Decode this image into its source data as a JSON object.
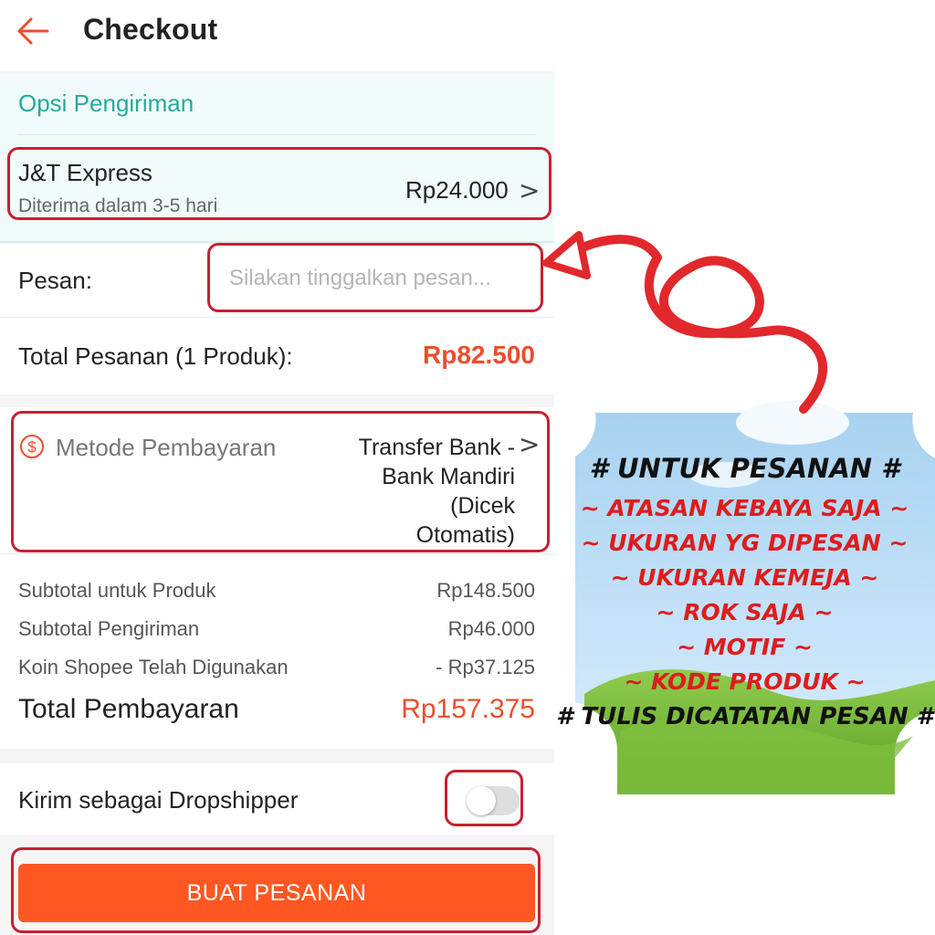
{
  "header": {
    "title": "Checkout",
    "back_icon": "arrow-left-icon",
    "accent": "#ee4d2d"
  },
  "shipping": {
    "section_title": "Opsi Pengiriman",
    "courier": "J&T Express",
    "eta": "Diterima dalam 3-5 hari",
    "price": "Rp24.000",
    "chevron": ">"
  },
  "message": {
    "label": "Pesan:",
    "placeholder": "Silakan tinggalkan pesan..."
  },
  "order_total": {
    "label": "Total Pesanan (1 Produk):",
    "value": "Rp82.500"
  },
  "payment": {
    "icon": "dollar-circle-icon",
    "label": "Metode Pembayaran",
    "value_lines": [
      "Transfer Bank -",
      "Bank Mandiri",
      "(Dicek",
      "Otomatis)"
    ],
    "chevron": ">"
  },
  "summary": {
    "rows": [
      {
        "label": "Subtotal untuk Produk",
        "value": "Rp148.500"
      },
      {
        "label": "Subtotal Pengiriman",
        "value": "Rp46.000"
      },
      {
        "label": "Koin Shopee Telah Digunakan",
        "value": "- Rp37.125"
      }
    ],
    "total_label": "Total Pembayaran",
    "total_value": "Rp157.375"
  },
  "dropship": {
    "label": "Kirim sebagai Dropshipper",
    "enabled": false
  },
  "order_button": {
    "label": "BUAT PESANAN",
    "color": "#ff5722"
  },
  "promo": {
    "heading": "# UNTUK PESANAN #",
    "lines": [
      "~ ATASAN KEBAYA SAJA ~",
      "~  UKURAN YG DIPESAN ~",
      "~  UKURAN KEMEJA ~",
      "~ ROK SAJA ~",
      "~ MOTIF ~",
      "~ KODE PRODUK ~"
    ],
    "footer": "# TULIS DICATATAN PESAN #",
    "highlight_color": "#c62032"
  }
}
